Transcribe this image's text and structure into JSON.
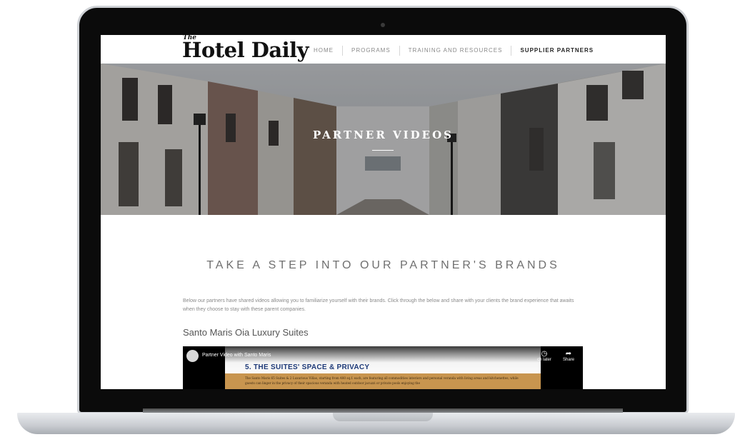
{
  "site": {
    "logo_the": "The",
    "logo_main": "Hotel Daily"
  },
  "nav": {
    "items": [
      {
        "label": "HOME"
      },
      {
        "label": "PROGRAMS"
      },
      {
        "label": "TRAINING AND RESOURCES"
      },
      {
        "label": "SUPPLIER PARTNERS"
      }
    ],
    "active_index": 3
  },
  "hero": {
    "title": "PARTNER VIDEOS"
  },
  "main": {
    "heading": "TAKE A STEP INTO OUR PARTNER'S BRANDS",
    "intro": "Below our partners have shared videos allowing you to familiarize yourself with their brands. Click through the below and share with your clients the brand experience that awaits when they choose to stay with these parent companies.",
    "partner_name": "Santo Maris Oia Luxury Suites"
  },
  "video": {
    "title": "Partner Video with Santo Maris",
    "slide_title": "5. THE SUITES' SPACE & PRIVACY",
    "slide_text": "The Santo Maris 65 Suites & 2 Luxurious Villas, starting from 480 sq.f. each, are featuring all commodities interiors and personal veranda with living areas and kitchenettes, while guests can linger in the privacy of their spacious veranda with heated outdoor jacuzzi or private pools enjoying the",
    "watch_later_label": "ch later",
    "share_label": "Share",
    "watch_later_icon": "clock-icon",
    "share_icon": "share-arrow-icon"
  },
  "colors": {
    "nav_active": "#222222",
    "nav_inactive": "#8a8a8a",
    "slide_title": "#1e3a78",
    "slide_band": "#c8954f"
  }
}
